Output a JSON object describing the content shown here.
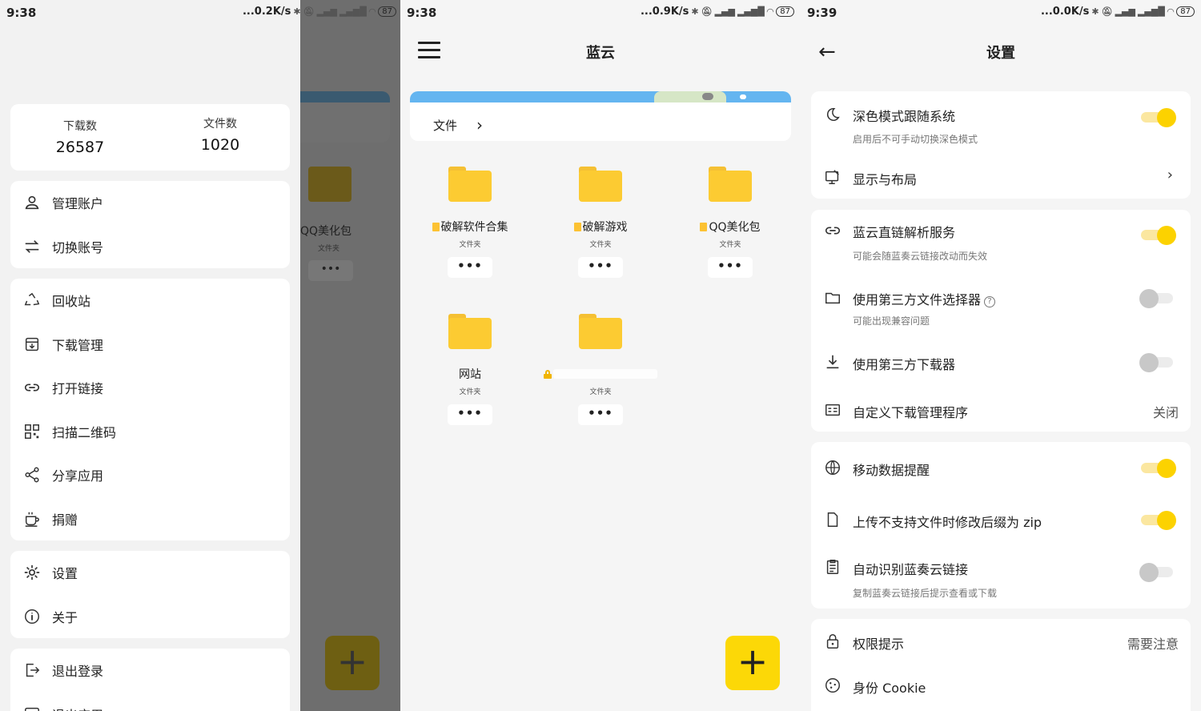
{
  "panel1": {
    "status": {
      "time": "9:38",
      "speed": "...0.2K/s",
      "battery": "87"
    },
    "stats": {
      "downloads_label": "下载数",
      "downloads_value": "26587",
      "files_label": "文件数",
      "files_value": "1020"
    },
    "items": {
      "manage_account": "管理账户",
      "switch_account": "切换账号",
      "recycle": "回收站",
      "download_manage": "下载管理",
      "open_link": "打开链接",
      "scan_qr": "扫描二维码",
      "share_app": "分享应用",
      "donate": "捐赠",
      "settings": "设置",
      "about": "关于",
      "logout": "退出登录",
      "exit_app": "退出应用"
    },
    "bg": {
      "folder_name": "QQ美化包",
      "folder_sub": "文件夹",
      "more": "•••",
      "fab": "+"
    }
  },
  "panel2": {
    "status": {
      "time": "9:38",
      "speed": "...0.9K/s",
      "battery": "87"
    },
    "title": "蓝云",
    "breadcrumb": {
      "label": "文件",
      "arrow": "›"
    },
    "folders": [
      {
        "name": "破解软件合集",
        "sub": "文件夹",
        "more": "•••"
      },
      {
        "name": "破解游戏",
        "sub": "文件夹",
        "more": "•••"
      },
      {
        "name": "QQ美化包",
        "sub": "文件夹",
        "more": "•••"
      },
      {
        "name": "网站",
        "sub": "文件夹",
        "more": "•••"
      },
      {
        "name": "",
        "sub": "文件夹",
        "more": "•••"
      }
    ],
    "fab": "+"
  },
  "panel3": {
    "status": {
      "time": "9:39",
      "speed": "...0.0K/s",
      "battery": "87"
    },
    "title": "设置",
    "back": "←",
    "rows": {
      "dark_mode": {
        "title": "深色模式跟随系统",
        "desc": "启用后不可手动切换深色模式",
        "on": true
      },
      "display_layout": {
        "title": "显示与布局",
        "chev": "›"
      },
      "direct_link": {
        "title": "蓝云直链解析服务",
        "desc": "可能会随蓝奏云链接改动而失效",
        "on": true
      },
      "third_picker": {
        "title": "使用第三方文件选择器",
        "desc": "可能出现兼容问题",
        "help": "?",
        "on": false
      },
      "third_downloader": {
        "title": "使用第三方下载器",
        "on": false
      },
      "custom_dl": {
        "title": "自定义下载管理程序",
        "value": "关闭"
      },
      "mobile_data": {
        "title": "移动数据提醒",
        "on": true
      },
      "upload_zip": {
        "title": "上传不支持文件时修改后缀为 zip",
        "on": true
      },
      "auto_detect": {
        "title": "自动识别蓝奏云链接",
        "desc": "复制蓝奏云链接后提示查看或下载",
        "on": false
      },
      "permission": {
        "title": "权限提示",
        "value": "需要注意"
      },
      "cookie": {
        "title": "身份 Cookie"
      }
    }
  },
  "colors": {
    "accent": "#fcd807",
    "folder": "#fccb32",
    "strip": "#64b5f0"
  }
}
